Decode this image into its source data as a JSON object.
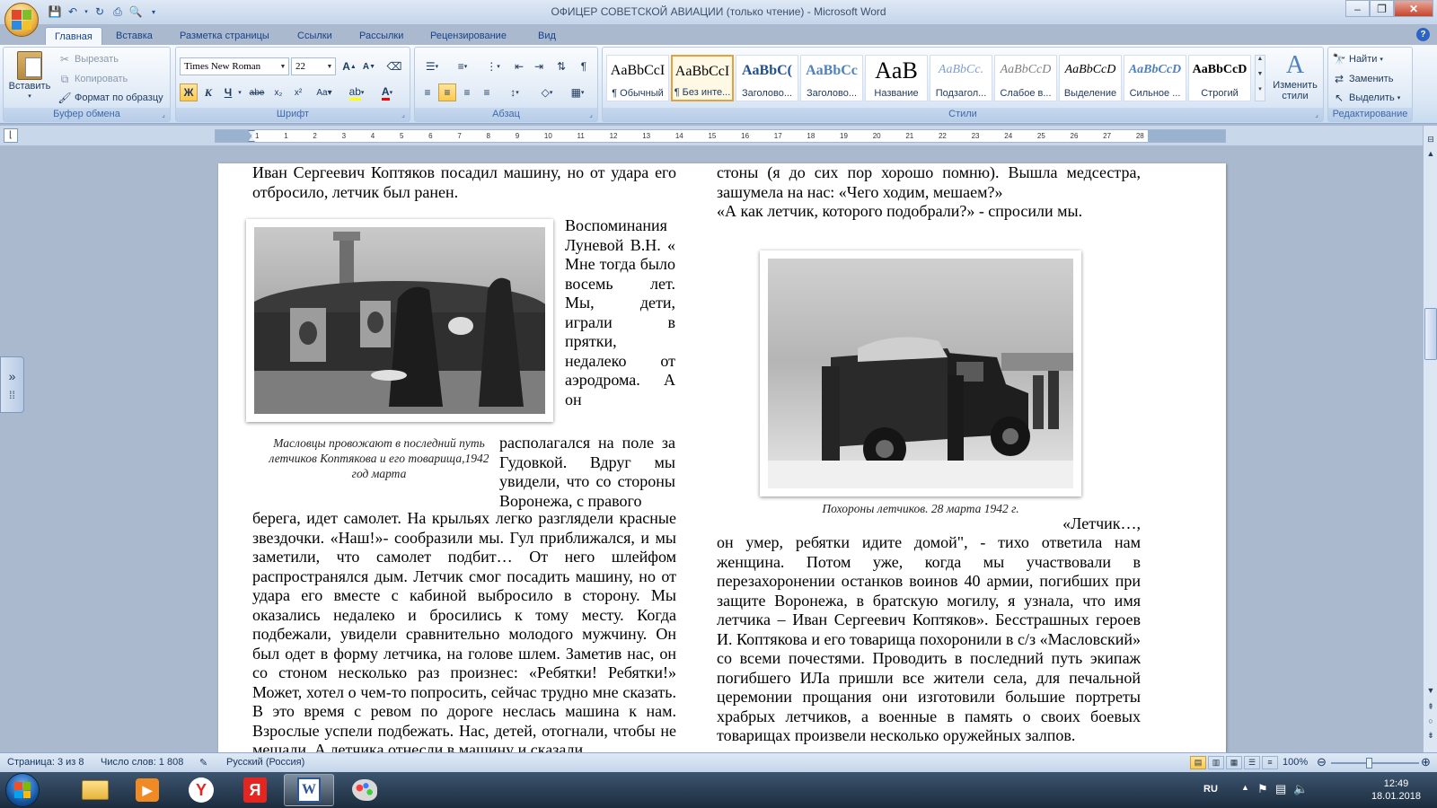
{
  "window": {
    "title": "ОФИЦЕР СОВЕТСКОЙ АВИАЦИИ (только чтение) - Microsoft Word"
  },
  "tabs": [
    "Главная",
    "Вставка",
    "Разметка страницы",
    "Ссылки",
    "Рассылки",
    "Рецензирование",
    "Вид"
  ],
  "ribbon": {
    "clipboard": {
      "label": "Буфер обмена",
      "paste": "Вставить",
      "cut": "Вырезать",
      "copy": "Копировать",
      "format_painter": "Формат по образцу"
    },
    "font": {
      "label": "Шрифт",
      "font_name": "Times New Roman",
      "font_size": "22"
    },
    "paragraph": {
      "label": "Абзац"
    },
    "styles": {
      "label": "Стили",
      "items": [
        {
          "sample": "AaBbCcI",
          "name": "¶ Обычный"
        },
        {
          "sample": "AaBbCcI",
          "name": "¶ Без инте..."
        },
        {
          "sample": "AaBbC(",
          "name": "Заголово..."
        },
        {
          "sample": "AaBbCc",
          "name": "Заголово..."
        },
        {
          "sample": "AaB",
          "name": "Название"
        },
        {
          "sample": "AaBbCc.",
          "name": "Подзагол..."
        },
        {
          "sample": "AaBbCcD",
          "name": "Слабое в..."
        },
        {
          "sample": "AaBbCcD",
          "name": "Выделение"
        },
        {
          "sample": "AaBbCcD",
          "name": "Сильное ..."
        },
        {
          "sample": "AaBbCcD",
          "name": "Строгий"
        }
      ],
      "change_styles": "Изменить стили"
    },
    "editing": {
      "label": "Редактирование",
      "find": "Найти",
      "replace": "Заменить",
      "select": "Выделить"
    }
  },
  "ruler": {
    "ticks": [
      "1",
      "1",
      "2",
      "3",
      "4",
      "5",
      "6",
      "7",
      "8",
      "9",
      "10",
      "11",
      "12",
      "13",
      "14",
      "15",
      "16",
      "17",
      "18",
      "19",
      "20",
      "21",
      "22",
      "23",
      "24",
      "25",
      "26",
      "27",
      "28"
    ]
  },
  "document": {
    "left_col": {
      "p1": "Иван Сергеевич Коптяков посадил машину, но от удара его отбросило, летчик был ранен.",
      "p2_narrow": "Воспоминания Луневой В.Н. « Мне тогда было восемь лет. Мы, дети, играли в прятки, недалеко от аэродрома. А он",
      "p2_mid": "располагался на поле за Гудовкой. Вдруг мы увидели, что со стороны Воронежа, с правого",
      "p2_full": "берега, идет самолет. На крыльях легко разглядели красные звездочки. «Наш!»- сообразили мы. Гул приближался, и мы заметили, что самолет подбит… От него шлейфом распространялся дым. Летчик смог посадить машину, но от удара его вместе с кабиной выбросило в сторону. Мы оказались недалеко и бросились к тому месту. Когда подбежали, увидели сравнительно молодого мужчину. Он был одет в форму летчика, на голове шлем. Заметив нас, он со стоном несколько раз произнес: «Ребятки! Ребятки!» Может, хотел о чем-то попросить, сейчас трудно мне сказать. В это время с ревом по дороге неслась машина к нам. Взрослые успели подбежать. Нас, детей, отогнали, чтобы не мешали. А летчика отнесли в машину и сказали"
    },
    "caption1": "Масловцы провожают в последний путь летчиков Коптякова и его товарища,1942 год марта",
    "right_col": {
      "p1": "стоны (я до сих пор хорошо помню). Вышла медсестра, зашумела на нас: «Чего ходим, мешаем?»",
      "p2": "«А как летчик, которого подобрали?» - спросили мы.",
      "p3_start": "«Летчик…,",
      "p3": "он умер, ребятки идите домой\", - тихо ответила нам женщина. Потом уже, когда мы участвовали в перезахоронении останков воинов 40 армии, погибших при защите Воронежа, в братскую могилу, я узнала, что имя летчика – Иван Сергеевич Коптяков». Бесстрашных героев И. Коптякова и его товарища похоронили в с/з «Масловский» со всеми почестями. Проводить в последний путь экипаж погибшего ИЛа пришли все жители села, для печальной церемонии прощания они изготовили большие портреты храбрых летчиков, а военные в память о своих боевых товарищах произвели несколько оружейных залпов."
    },
    "caption2": "Похороны летчиков. 28 марта 1942 г."
  },
  "status": {
    "page": "Страница: 3 из 8",
    "words": "Число слов: 1 808",
    "language": "Русский (Россия)",
    "zoom": "100%"
  },
  "taskbar": {
    "lang": "RU",
    "time": "12:49",
    "date": "18.01.2018"
  },
  "colors": {
    "accent": "#2b579a",
    "highlight_active": "#ffc94a"
  }
}
